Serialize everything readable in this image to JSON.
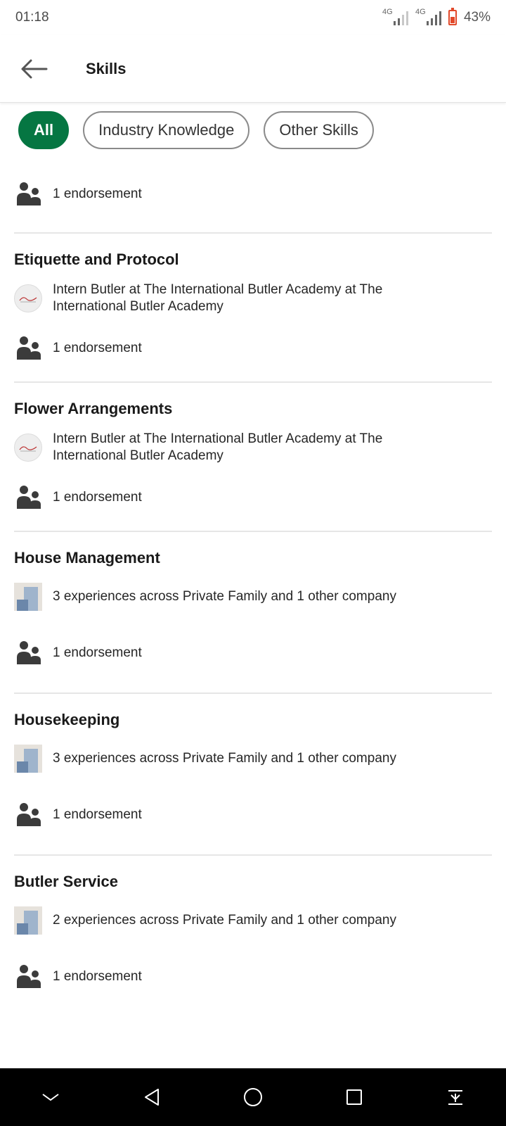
{
  "status": {
    "time": "01:18",
    "net1": "4G",
    "net2": "4G",
    "battery": "43%"
  },
  "header": {
    "title": "Skills"
  },
  "filters": [
    {
      "label": "All",
      "active": true
    },
    {
      "label": "Industry Knowledge",
      "active": false
    },
    {
      "label": "Other Skills",
      "active": false
    }
  ],
  "first_endorsement": "1 endorsement",
  "skills": [
    {
      "name": "Etiquette and Protocol",
      "experience": "Intern Butler at The International Butler Academy at The International Butler Academy",
      "endorsement": "1 endorsement"
    },
    {
      "name": "Flower Arrangements",
      "experience": "Intern Butler at The International Butler Academy at The International Butler Academy",
      "endorsement": "1 endorsement"
    },
    {
      "name": "House Management",
      "experience": "3 experiences across Private Family and 1 other company",
      "endorsement": "1 endorsement"
    },
    {
      "name": "Housekeeping",
      "experience": "3 experiences across Private Family and 1 other company",
      "endorsement": "1 endorsement"
    },
    {
      "name": "Butler Service",
      "experience": "2 experiences across Private Family and 1 other company",
      "endorsement": "1 endorsement"
    }
  ],
  "colors": {
    "accent": "#057642",
    "icon": "#3b3b3b"
  }
}
